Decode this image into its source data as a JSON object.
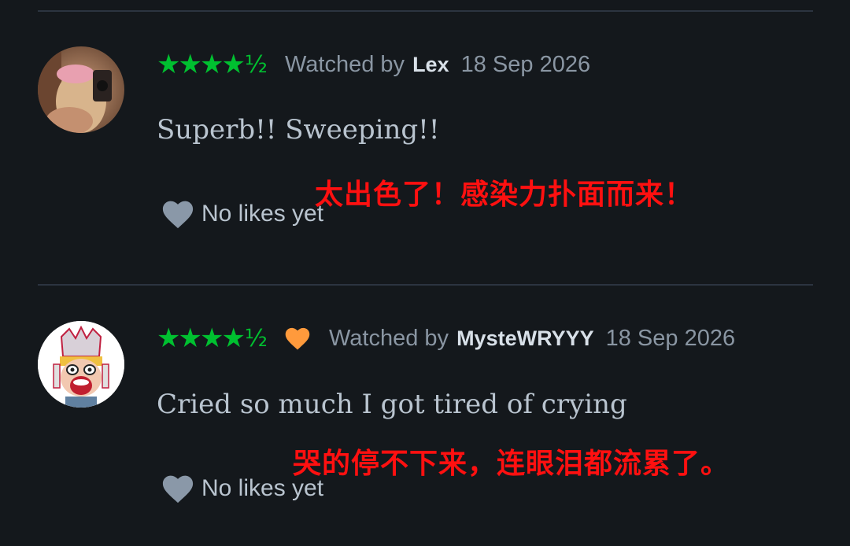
{
  "reviews": [
    {
      "rating_stars": "★★★★",
      "rating_half": "½",
      "rating_value": 4.5,
      "liked": false,
      "watched_by_prefix": "Watched by",
      "username": "Lex",
      "date": "18 Sep 2026",
      "text": "Superb!! Sweeping!!",
      "translation": "太出色了！感染力扑面而来！",
      "likes_label": "No likes yet"
    },
    {
      "rating_stars": "★★★★",
      "rating_half": "½",
      "rating_value": 4.5,
      "liked": true,
      "watched_by_prefix": "Watched by",
      "username": "MysteWRYYY",
      "date": "18 Sep 2026",
      "text": "Cried so much I got tired of crying",
      "translation": "哭的停不下来，连眼泪都流累了。",
      "likes_label": "No likes yet"
    }
  ],
  "icons": {
    "like_heart": "heart-icon",
    "liked_heart": "heart-filled-icon"
  },
  "colors": {
    "background": "#14181c",
    "star_green": "#00c030",
    "liked_orange": "#ff9a3c",
    "translation_red": "#ff1010",
    "muted_text": "#8a96a3"
  }
}
